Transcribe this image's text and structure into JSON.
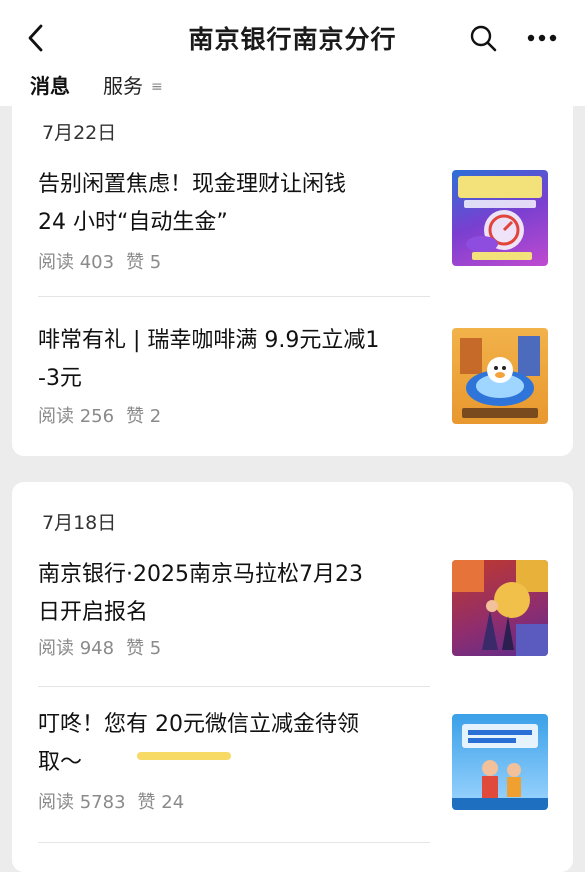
{
  "header": {
    "title": "南京银行南京分行",
    "back_icon": "chevron-left-icon",
    "search_icon": "search-icon",
    "more_icon": "more-horizontal-icon"
  },
  "tabs": [
    {
      "label": "消息",
      "active": true
    },
    {
      "label": "服务",
      "menu_glyph": "≡"
    }
  ],
  "groups": [
    {
      "date": "7月22日",
      "articles": [
        {
          "title": "告别闲置焦虑！现金理财让闲钱24 小时“自动生金”",
          "title_line1": "告别闲置焦虑！现金理财让闲钱",
          "title_line2": "24 小时“自动生金”",
          "reads_label": "阅读 403",
          "likes_label": "赞 5"
        },
        {
          "title": "啡常有礼 | 瑞幸咖啡满 9.9元立减1-3元",
          "title_line1": "啡常有礼 | 瑞幸咖啡满 9.9元立减1",
          "title_line2": "-3元",
          "reads_label": "阅读 256",
          "likes_label": "赞 2"
        }
      ]
    },
    {
      "date": "7月18日",
      "articles": [
        {
          "title": "南京银行·2025南京马拉松7月23日开启报名",
          "title_line1": "南京银行·2025南京马拉松7月23",
          "title_line2": "日开启报名",
          "reads_label": "阅读 948",
          "likes_label": "赞 5"
        },
        {
          "title": "叮咚！您有 20元微信立减金待领取～",
          "title_line1": "叮咚！您有 20元微信立减金待领",
          "title_line2": "取～",
          "reads_label": "阅读 5783",
          "likes_label": "赞 24"
        }
      ]
    }
  ],
  "colors": {
    "background": "#ececec",
    "card": "#ffffff",
    "meta_text": "#8a8a8a",
    "highlight": "#f4d34a"
  }
}
